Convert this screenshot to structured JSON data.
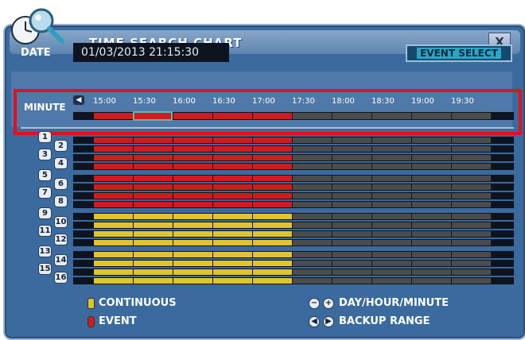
{
  "window": {
    "title": "TIME SEARCH CHART",
    "close_label": "X"
  },
  "date": {
    "label": "DATE",
    "value": "01/03/2013 21:15:30"
  },
  "event_select": {
    "label": "EVENT SELECT"
  },
  "minute": {
    "label": "MINUTE",
    "rewind_icon": "rewind-icon",
    "ticks": [
      "15:00",
      "15:30",
      "16:00",
      "16:30",
      "17:00",
      "17:30",
      "18:00",
      "18:30",
      "19:00",
      "19:30"
    ]
  },
  "cameras": [
    "1",
    "2",
    "3",
    "4",
    "5",
    "6",
    "7",
    "8",
    "9",
    "10",
    "11",
    "12",
    "13",
    "14",
    "15",
    "16"
  ],
  "colors": {
    "event": "#d01c1c",
    "continuous": "#e1c32e",
    "empty": "#4c4c4c",
    "cursor": "#5fb7b1"
  },
  "legend": {
    "continuous": "CONTINUOUS",
    "event": "EVENT",
    "day_hour_minute": "DAY/HOUR/MINUTE",
    "backup_range": "BACKUP RANGE"
  }
}
